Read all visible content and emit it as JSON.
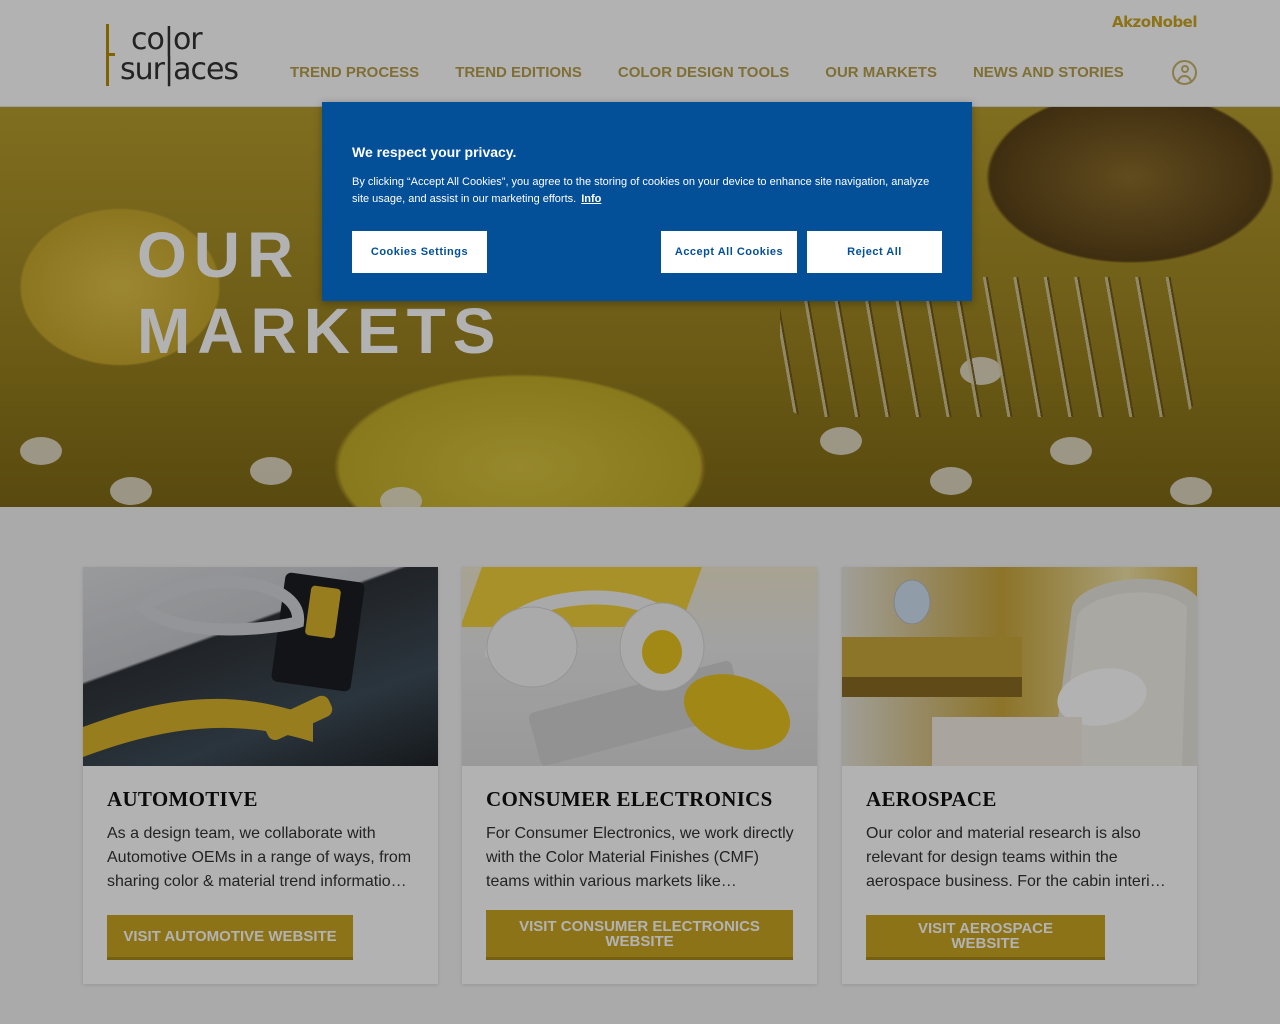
{
  "brand": {
    "logo_line1": "co|or",
    "logo_line2": "sur|aces",
    "parent_brand": "AkzoNobel"
  },
  "nav": {
    "items": [
      {
        "label": "TREND PROCESS"
      },
      {
        "label": "TREND EDITIONS"
      },
      {
        "label": "COLOR DESIGN TOOLS"
      },
      {
        "label": "OUR MARKETS"
      },
      {
        "label": "NEWS AND STORIES"
      }
    ],
    "user_icon": "user-circle-icon"
  },
  "hero": {
    "title_line1": "OUR",
    "title_line2": "MARKETS"
  },
  "cards": [
    {
      "title": "AUTOMOTIVE",
      "text": "As a design team, we collaborate with Automotive OEMs in a range of ways, from sharing color & material trend informatio…",
      "button": "VISIT AUTOMOTIVE WEBSITE"
    },
    {
      "title": "CONSUMER ELECTRONICS",
      "text": "For Consumer Electronics, we work directly with the Color Material Finishes (CMF) teams within various markets like…",
      "button": "VISIT CONSUMER ELECTRONICS WEBSITE"
    },
    {
      "title": "AEROSPACE",
      "text": "Our color and material research is also relevant for design teams within the aerospace business. For the cabin interi…",
      "button": "VISIT AEROSPACE WEBSITE"
    }
  ],
  "cookie_banner": {
    "title": "We respect your privacy.",
    "text": "By clicking “Accept All Cookies”, you agree to the storing of cookies on your device to enhance site navigation, analyze site usage, and assist in our marketing efforts.",
    "info_link": "Info",
    "settings_button": "Cookies Settings",
    "accept_button": "Accept All Cookies",
    "reject_button": "Reject All"
  },
  "colors": {
    "accent_gold": "#c9a521",
    "cookie_blue": "#034f98"
  }
}
